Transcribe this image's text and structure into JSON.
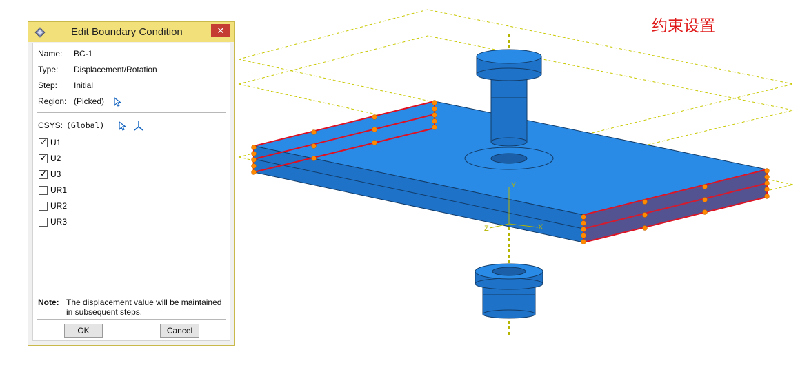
{
  "dialog": {
    "title": "Edit Boundary Condition",
    "close_label": "✕",
    "fields": [
      {
        "label": "Name:",
        "value": "BC-1"
      },
      {
        "label": "Type:",
        "value": "Displacement/Rotation"
      },
      {
        "label": "Step:",
        "value": "Initial"
      },
      {
        "label": "Region:",
        "value": "(Picked)"
      }
    ],
    "csys_label": "CSYS:",
    "csys_value": "(Global)",
    "checkboxes": [
      {
        "label": "U1",
        "checked": true
      },
      {
        "label": "U2",
        "checked": true
      },
      {
        "label": "U3",
        "checked": true
      },
      {
        "label": "UR1",
        "checked": false
      },
      {
        "label": "UR2",
        "checked": false
      },
      {
        "label": "UR3",
        "checked": false
      }
    ],
    "note_label": "Note:",
    "note_text": "The displacement value will be maintained in subsequent steps.",
    "ok_label": "OK",
    "cancel_label": "Cancel"
  },
  "viewport": {
    "caption": "约束设置",
    "axis_labels": {
      "y": "Y",
      "x": "X",
      "z": "Z"
    },
    "colors": {
      "part_blue": "#1e7ad8",
      "edge_red": "#e01020",
      "bc_marker_orange": "#ff8a00",
      "axis_line": "#b5b500"
    }
  }
}
